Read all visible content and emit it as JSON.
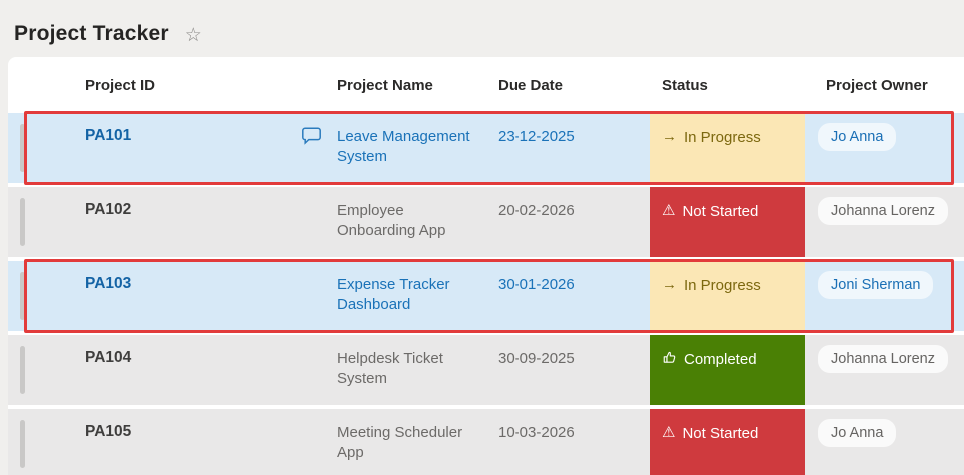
{
  "page": {
    "title": "Project Tracker",
    "favorite_icon": "☆"
  },
  "table": {
    "columns": {
      "id": "Project ID",
      "name": "Project Name",
      "due": "Due Date",
      "status": "Status",
      "owner": "Project Owner"
    },
    "rows": [
      {
        "id": "PA101",
        "name": "Leave Management System",
        "due": "23-12-2025",
        "status": "In Progress",
        "status_kind": "in-progress",
        "owner": "Jo Anna",
        "highlighted": true,
        "has_comment": true
      },
      {
        "id": "PA102",
        "name": "Employee Onboarding App",
        "due": "20-02-2026",
        "status": "Not Started",
        "status_kind": "not-started",
        "owner": "Johanna Lorenz",
        "highlighted": false,
        "has_comment": false
      },
      {
        "id": "PA103",
        "name": "Expense Tracker Dashboard",
        "due": "30-01-2026",
        "status": "In Progress",
        "status_kind": "in-progress",
        "owner": "Joni Sherman",
        "highlighted": true,
        "has_comment": false
      },
      {
        "id": "PA104",
        "name": "Helpdesk Ticket System",
        "due": "30-09-2025",
        "status": "Completed",
        "status_kind": "completed",
        "owner": "Johanna Lorenz",
        "highlighted": false,
        "has_comment": false
      },
      {
        "id": "PA105",
        "name": "Meeting Scheduler App",
        "due": "10-03-2026",
        "status": "Not Started",
        "status_kind": "not-started",
        "owner": "Jo Anna",
        "highlighted": false,
        "has_comment": false
      }
    ],
    "status_glyphs": {
      "in-progress": "→",
      "not-started": "⚠",
      "completed": "thumbs-up"
    },
    "colors": {
      "in_progress_bg": "#fbe7b5",
      "in_progress_fg": "#7c680f",
      "not_started_bg": "#cf3a3e",
      "completed_bg": "#4a8005",
      "highlight_row_bg": "#d7e9f7",
      "row_bg": "#e9e8e8",
      "link_blue": "#1a72b8",
      "annotation_red": "#e23b3b"
    }
  }
}
